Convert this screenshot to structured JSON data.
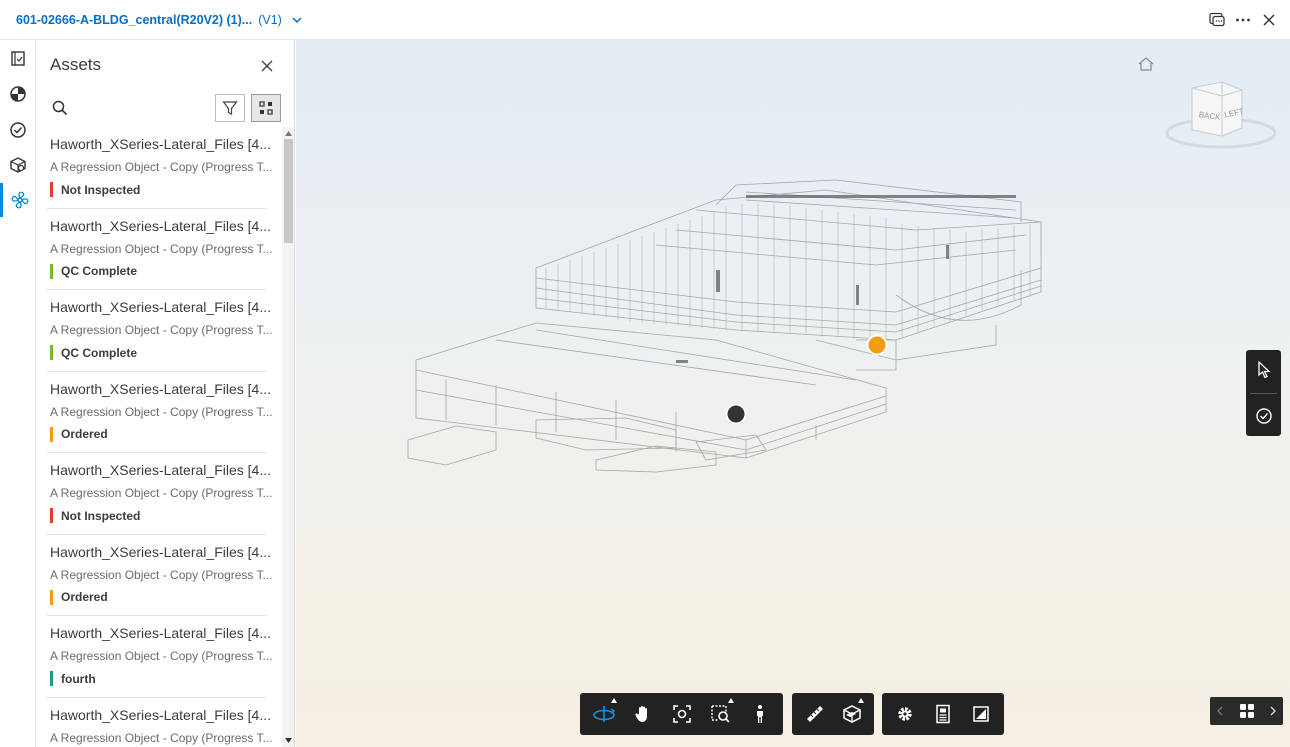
{
  "header": {
    "doc_title": "601-02666-A-BLDG_central(R20V2) (1)...",
    "doc_version": "(V1)",
    "icons": [
      "chevron-down-icon",
      "chat-icon",
      "more-icon",
      "close-icon"
    ]
  },
  "rail": {
    "items": [
      {
        "icon": "sheets-icon"
      },
      {
        "icon": "model-icon"
      },
      {
        "icon": "checklist-icon"
      },
      {
        "icon": "cube-icon"
      },
      {
        "icon": "assets-fan-icon",
        "active": true
      }
    ]
  },
  "assets_panel": {
    "title": "Assets",
    "search": {
      "placeholder": "",
      "value": ""
    },
    "items": [
      {
        "title": "Haworth_XSeries-Lateral_Files [4...",
        "subtitle": "A Regression Object - Copy (Progress T...",
        "status": "Not Inspected",
        "status_color": "#e03c31"
      },
      {
        "title": "Haworth_XSeries-Lateral_Files [4...",
        "subtitle": "A Regression Object - Copy (Progress T...",
        "status": "QC Complete",
        "status_color": "#7cb82f"
      },
      {
        "title": "Haworth_XSeries-Lateral_Files [4...",
        "subtitle": "A Regression Object - Copy (Progress T...",
        "status": "QC Complete",
        "status_color": "#7cb82f"
      },
      {
        "title": "Haworth_XSeries-Lateral_Files [4...",
        "subtitle": "A Regression Object - Copy (Progress T...",
        "status": "Ordered",
        "status_color": "#f39c12"
      },
      {
        "title": "Haworth_XSeries-Lateral_Files [4...",
        "subtitle": "A Regression Object - Copy (Progress T...",
        "status": "Not Inspected",
        "status_color": "#e03c31"
      },
      {
        "title": "Haworth_XSeries-Lateral_Files [4...",
        "subtitle": "A Regression Object - Copy (Progress T...",
        "status": "Ordered",
        "status_color": "#f39c12"
      },
      {
        "title": "Haworth_XSeries-Lateral_Files [4...",
        "subtitle": "A Regression Object - Copy (Progress T...",
        "status": "fourth",
        "status_color": "#1a9c8c"
      },
      {
        "title": "Haworth_XSeries-Lateral_Files [4...",
        "subtitle": "A Regression Object - Copy (Progress T...",
        "status": "",
        "status_color": ""
      }
    ]
  },
  "viewer": {
    "viewcube": {
      "back_label": "BACK",
      "left_label": "LEFT"
    },
    "markers": [
      {
        "color": "#f39c12"
      },
      {
        "color": "#333333"
      }
    ],
    "toolbar_groups": [
      [
        "orbit-icon",
        "pan-icon",
        "fit-to-view-icon",
        "zoom-window-icon",
        "first-person-icon"
      ],
      [
        "measure-icon",
        "section-box-icon"
      ],
      [
        "settings-icon",
        "properties-icon",
        "fullscreen-icon"
      ]
    ],
    "side_tools": [
      "select-cursor-icon",
      "check-circle-icon"
    ],
    "accent_color": "#1d8fe1"
  }
}
